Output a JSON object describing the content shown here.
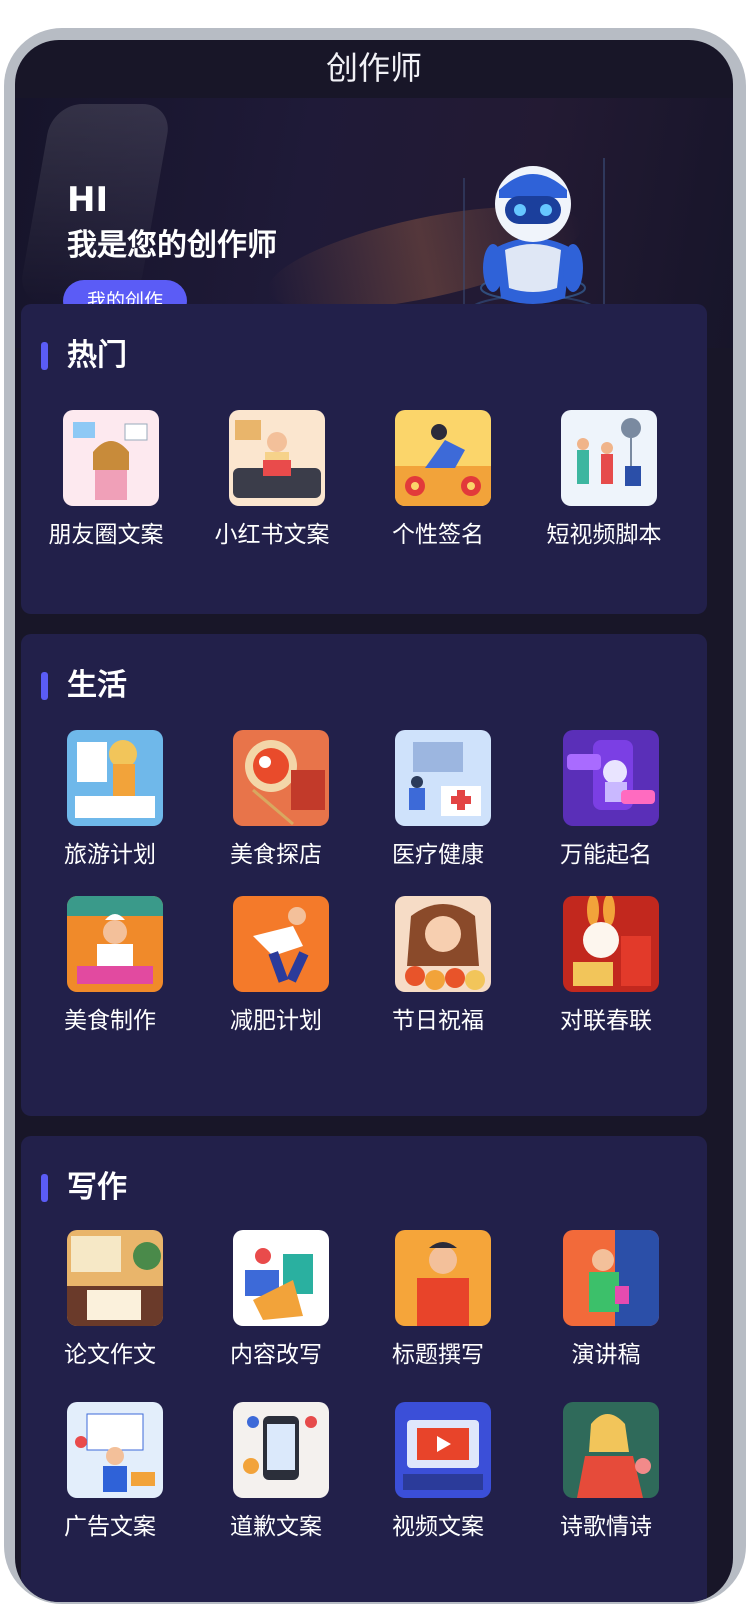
{
  "app": {
    "title": "创作师"
  },
  "banner": {
    "hi": "HI",
    "greeting": "我是您的创作师",
    "button_label": "我的创作"
  },
  "sections": [
    {
      "title": "热门",
      "items": [
        {
          "label": "朋友圈文案",
          "icon": "social-moments-illustration"
        },
        {
          "label": "小红书文案",
          "icon": "xiaohongshu-illustration"
        },
        {
          "label": "个性签名",
          "icon": "signature-illustration"
        },
        {
          "label": "短视频脚本",
          "icon": "video-script-illustration"
        }
      ]
    },
    {
      "title": "生活",
      "items": [
        {
          "label": "旅游计划",
          "icon": "travel-illustration"
        },
        {
          "label": "美食探店",
          "icon": "food-explore-illustration"
        },
        {
          "label": "医疗健康",
          "icon": "medical-illustration"
        },
        {
          "label": "万能起名",
          "icon": "naming-robot-illustration"
        },
        {
          "label": "美食制作",
          "icon": "cooking-illustration"
        },
        {
          "label": "减肥计划",
          "icon": "fitness-illustration"
        },
        {
          "label": "节日祝福",
          "icon": "holiday-wishes-illustration"
        },
        {
          "label": "对联春联",
          "icon": "couplets-illustration"
        }
      ]
    },
    {
      "title": "写作",
      "items": [
        {
          "label": "论文作文",
          "icon": "essay-illustration"
        },
        {
          "label": "内容改写",
          "icon": "rewrite-illustration"
        },
        {
          "label": "标题撰写",
          "icon": "headline-illustration"
        },
        {
          "label": "演讲稿",
          "icon": "speech-illustration"
        },
        {
          "label": "广告文案",
          "icon": "ad-copy-illustration"
        },
        {
          "label": "道歉文案",
          "icon": "apology-illustration"
        },
        {
          "label": "视频文案",
          "icon": "video-copy-illustration"
        },
        {
          "label": "诗歌情诗",
          "icon": "poetry-illustration"
        }
      ]
    }
  ],
  "colors": {
    "accent": "#5b5cf6",
    "card": "#22204a",
    "background": "#181628"
  }
}
